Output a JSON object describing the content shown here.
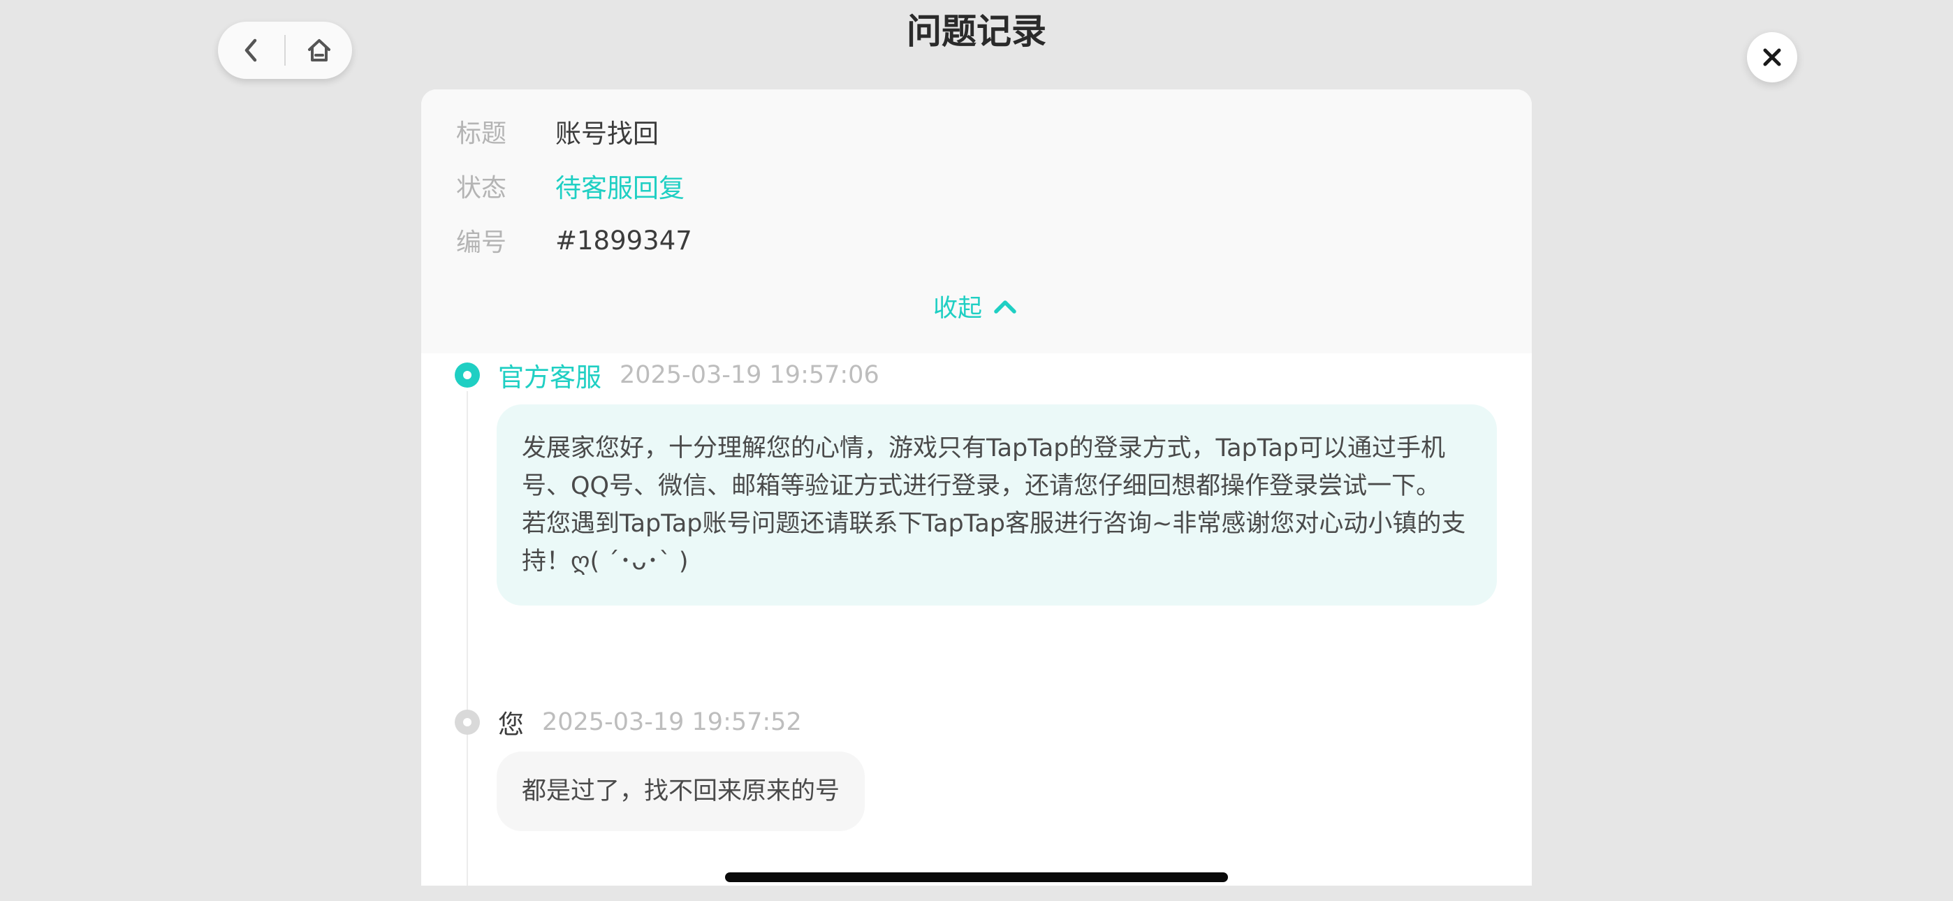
{
  "header": {
    "title": "问题记录"
  },
  "ticket": {
    "title_label": "标题",
    "title_value": "账号找回",
    "status_label": "状态",
    "status_value": "待客服回复",
    "id_label": "编号",
    "id_value": "#1899347",
    "collapse_label": "收起"
  },
  "messages": [
    {
      "sender": "官方客服",
      "time": "2025-03-19 19:57:06",
      "paragraphs": [
        "发展家您好，十分理解您的心情，游戏只有TapTap的登录方式，TapTap可以通过手机号、QQ号、微信、邮箱等验证方式进行登录，还请您仔细回想都操作登录尝试一下。",
        "若您遇到TapTap账号问题还请联系下TapTap客服进行咨询~非常感谢您对心动小镇的支持！ღ( ´･ᴗ･` )"
      ]
    },
    {
      "sender": "您",
      "time": "2025-03-19 19:57:52",
      "text": "都是过了，找不回来原来的号"
    }
  ],
  "colors": {
    "accent": "#1fcfc3",
    "background": "#e6e6e6",
    "service_bubble": "#ebf9f8",
    "user_bubble": "#f6f6f6"
  },
  "icons": {
    "back": "chevron-left-icon",
    "home": "home-icon",
    "close": "close-icon",
    "collapse": "chevron-up-icon"
  }
}
